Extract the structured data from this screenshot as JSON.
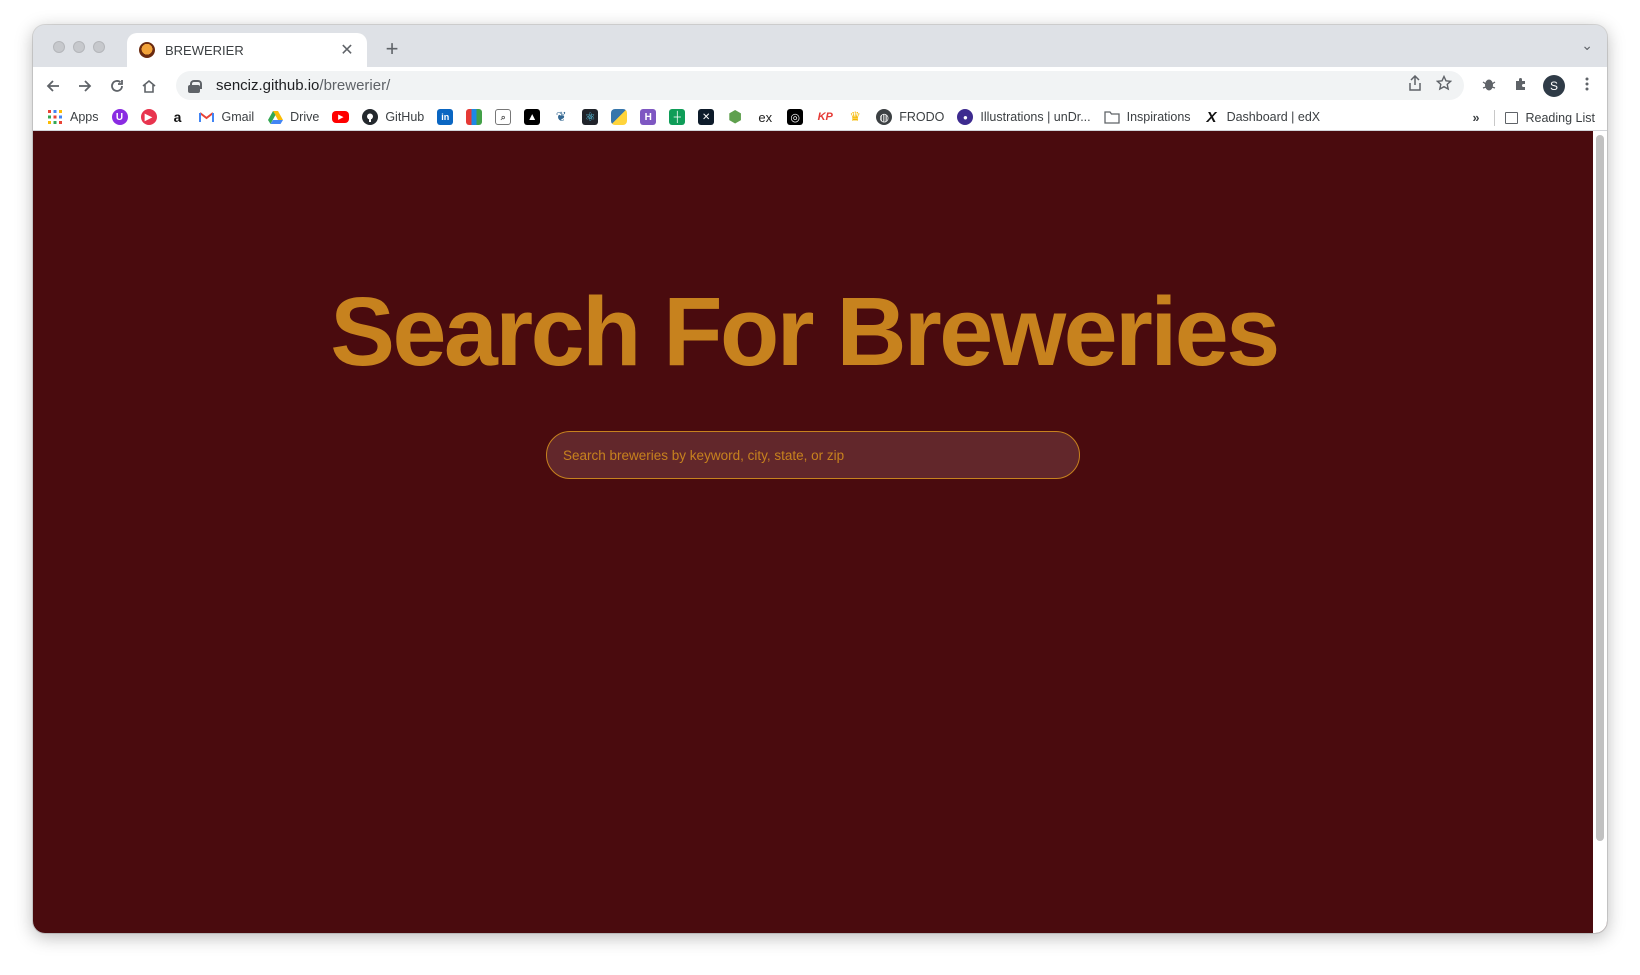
{
  "browser": {
    "tab": {
      "title": "BREWERIER",
      "close_glyph": "✕"
    },
    "new_tab_glyph": "+",
    "tab_menu_glyph": "⌄",
    "url": {
      "host": "senciz.github.io",
      "path": "/brewerier/"
    },
    "profile_initial": "S"
  },
  "bookmarks": {
    "items": [
      {
        "label": "Apps",
        "icon": "apps-grid-icon"
      },
      {
        "label": "",
        "icon": "u-icon"
      },
      {
        "label": "",
        "icon": "play-icon"
      },
      {
        "label": "",
        "icon": "amazon-icon"
      },
      {
        "label": "Gmail",
        "icon": "gmail-icon"
      },
      {
        "label": "Drive",
        "icon": "drive-icon"
      },
      {
        "label": "",
        "icon": "youtube-icon"
      },
      {
        "label": "GitHub",
        "icon": "github-icon"
      },
      {
        "label": "",
        "icon": "linkedin-icon"
      },
      {
        "label": "",
        "icon": "colored-blocks-icon"
      },
      {
        "label": "",
        "icon": "search-box-icon"
      },
      {
        "label": "",
        "icon": "graduation-cap-icon"
      },
      {
        "label": "",
        "icon": "elephant-icon"
      },
      {
        "label": "",
        "icon": "react-icon"
      },
      {
        "label": "",
        "icon": "python-icon"
      },
      {
        "label": "",
        "icon": "h-icon"
      },
      {
        "label": "",
        "icon": "sheets-icon"
      },
      {
        "label": "",
        "icon": "x-box-icon"
      },
      {
        "label": "",
        "icon": "hexagon-icon"
      },
      {
        "label": "",
        "icon": "ex-icon"
      },
      {
        "label": "",
        "icon": "circle-target-icon"
      },
      {
        "label": "",
        "icon": "kp-icon"
      },
      {
        "label": "",
        "icon": "crown-icon"
      },
      {
        "label": "FRODO",
        "icon": "globe-icon"
      },
      {
        "label": "Illustrations | unDr...",
        "icon": "undraw-icon"
      },
      {
        "label": "Inspirations",
        "icon": "folder-icon"
      },
      {
        "label": "Dashboard | edX",
        "icon": "edx-icon"
      }
    ],
    "overflow_glyph": "»",
    "reading_list": "Reading List"
  },
  "page": {
    "title": "Search For Breweries",
    "search_placeholder": "Search breweries by keyword, city, state, or zip"
  },
  "colors": {
    "page_background": "#4a0b0e",
    "accent": "#c7821e",
    "input_background": "#62272b"
  }
}
